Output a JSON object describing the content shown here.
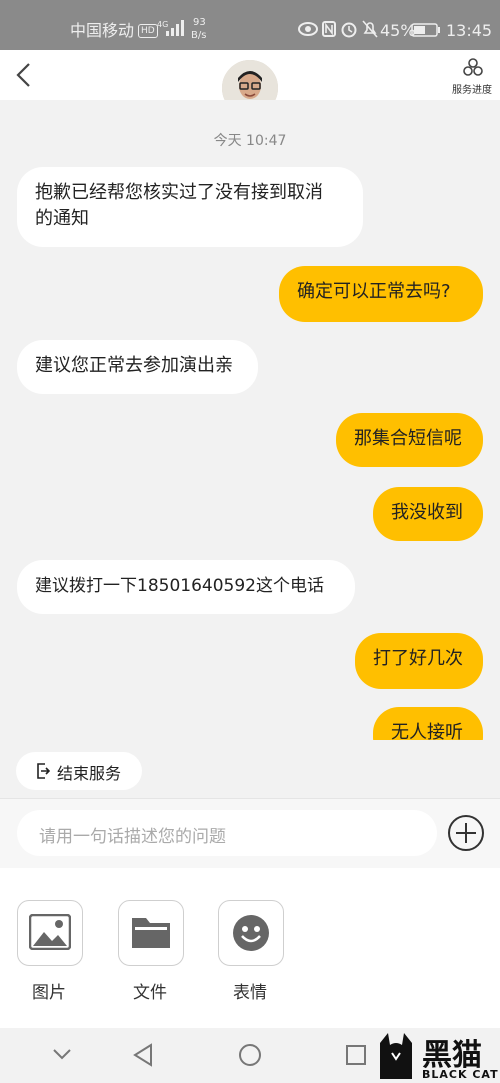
{
  "status_bar": {
    "carrier": "中国移动",
    "hd": "HD",
    "network": "4G",
    "speed_value": "93",
    "speed_unit": "B/s",
    "battery": "45%",
    "time": "13:45"
  },
  "header": {
    "back_icon": "chevron-left-icon",
    "service_progress_label": "服务进度"
  },
  "chat": {
    "timestamp": "今天 10:47",
    "messages": [
      {
        "side": "left",
        "line1": "抱歉已经帮您核实过了没有接到取消",
        "line2": "的通知"
      },
      {
        "side": "right",
        "text": "确定可以正常去吗?"
      },
      {
        "side": "left",
        "text": "建议您正常去参加演出亲"
      },
      {
        "side": "right",
        "text": "那集合短信呢"
      },
      {
        "side": "right",
        "text": "我没收到"
      },
      {
        "side": "left",
        "text": "建议拨打一下18501640592这个电话"
      },
      {
        "side": "right",
        "text": "打了好几次"
      },
      {
        "side": "right",
        "text": "无人接听"
      }
    ]
  },
  "end_service_label": "结束服务",
  "input": {
    "placeholder": "请用一句话描述您的问题"
  },
  "tools": [
    {
      "label": "图片",
      "icon": "image-icon"
    },
    {
      "label": "文件",
      "icon": "folder-icon"
    },
    {
      "label": "表情",
      "icon": "emoji-icon"
    }
  ],
  "watermark": {
    "cn": "黑猫",
    "en": "BLACK CAT"
  },
  "colors": {
    "accent": "#ffbf00",
    "status_bar": "#8a8a8a",
    "background": "#f2f2f2"
  }
}
